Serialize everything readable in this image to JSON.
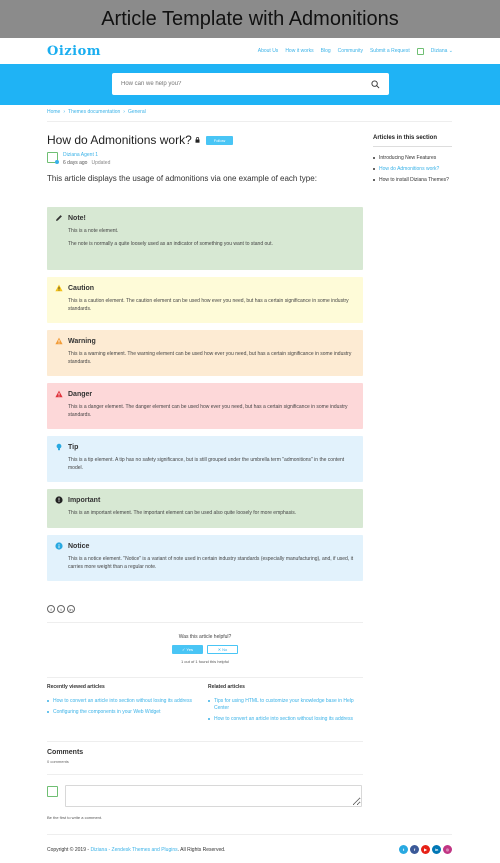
{
  "banner": {
    "title": "Article Template with Admonitions"
  },
  "header": {
    "logo": "Oiziom",
    "nav": [
      "About Us",
      "How it works",
      "Blog",
      "Community",
      "Submit a Request"
    ],
    "user": "Diziana"
  },
  "search": {
    "placeholder": "How can we help you?"
  },
  "breadcrumb": [
    "Home",
    "Themes documentation",
    "General"
  ],
  "article": {
    "title": "How do Admonitions work?",
    "follow_label": "Follow",
    "author": "Diziana Agent 1",
    "posted": "6 days ago",
    "updated": "Updated",
    "intro": "This article displays the usage of admonitions via one example of each type:"
  },
  "admonitions": [
    {
      "label": "Note!",
      "icon": "pencil-icon",
      "color": "#d7e8d3",
      "text": [
        "This is a note element.",
        "The note is normally a quite loosely used as an indicator of something you want to stand out."
      ]
    },
    {
      "label": "Caution",
      "icon": "caution-triangle-icon",
      "color": "#fefbd8",
      "text": [
        "This is a caution element. The caution element can be used how ever you need, but has a certain significance in some industry standards."
      ]
    },
    {
      "label": "Warning",
      "icon": "warning-triangle-icon",
      "color": "#fdebd3",
      "text": [
        "This is a warning element. The warning element can be used how ever you need, but has a certain significance in some industry standards."
      ]
    },
    {
      "label": "Danger",
      "icon": "danger-triangle-icon",
      "color": "#fdd8d9",
      "text": [
        "This is a danger element. The danger element can be used how ever you need, but has a certain significance in some industry standards."
      ]
    },
    {
      "label": "Tip",
      "icon": "lightbulb-icon",
      "color": "#e2f2fc",
      "text": [
        "This is a tip element. A tip has no safety significance, but is still grouped under the umbrella term \"admonitions\" in the content model."
      ]
    },
    {
      "label": "Important",
      "icon": "exclamation-circle-icon",
      "color": "#d7e8d3",
      "text": [
        "This is an important element. The important element can be used also quite loosely for more emphasis."
      ]
    },
    {
      "label": "Notice",
      "icon": "info-circle-icon",
      "color": "#e2f2fc",
      "text": [
        "This is a notice element. \"Notice\" is a variant of note used in certain industry standards (especially manufacturing), and, if used, it carries more weight than a regular note."
      ]
    }
  ],
  "share": [
    "f",
    "t",
    "in"
  ],
  "feedback": {
    "question": "Was this article helpful?",
    "yes": "✓  Yes",
    "no": "✕  No",
    "count": "1 out of 1 found this helpful"
  },
  "recently_viewed": {
    "title": "Recently viewed articles",
    "items": [
      "How to convert an article into section without losing its address",
      "Configuring the components in your Web Widget"
    ]
  },
  "related": {
    "title": "Related articles",
    "items": [
      "Tips for using HTML to customize your knowledge base in Help Center",
      "How to convert an article into section without losing its address"
    ]
  },
  "comments": {
    "title": "Comments",
    "count": "0 comments",
    "first": "Be the first to write a comment."
  },
  "footer": {
    "prefix": "Copyright © 2019 - ",
    "link": "Diziana - Zendesk Themes and Plugins",
    "suffix": ". All Rights Reserved."
  },
  "socials": [
    {
      "name": "twitter-icon",
      "glyph": "t",
      "color": "#29a9e1"
    },
    {
      "name": "facebook-icon",
      "glyph": "f",
      "color": "#3b5998"
    },
    {
      "name": "youtube-icon",
      "glyph": "▶",
      "color": "#e62117"
    },
    {
      "name": "linkedin-icon",
      "glyph": "in",
      "color": "#0077b5"
    },
    {
      "name": "instagram-icon",
      "glyph": "◎",
      "color": "#c13584"
    }
  ],
  "sidebar": {
    "title": "Articles in this section",
    "items": [
      "Introducing New Features",
      "How do Admonitions work?",
      "How to install Diziana Themes?"
    ],
    "active_index": 1
  }
}
